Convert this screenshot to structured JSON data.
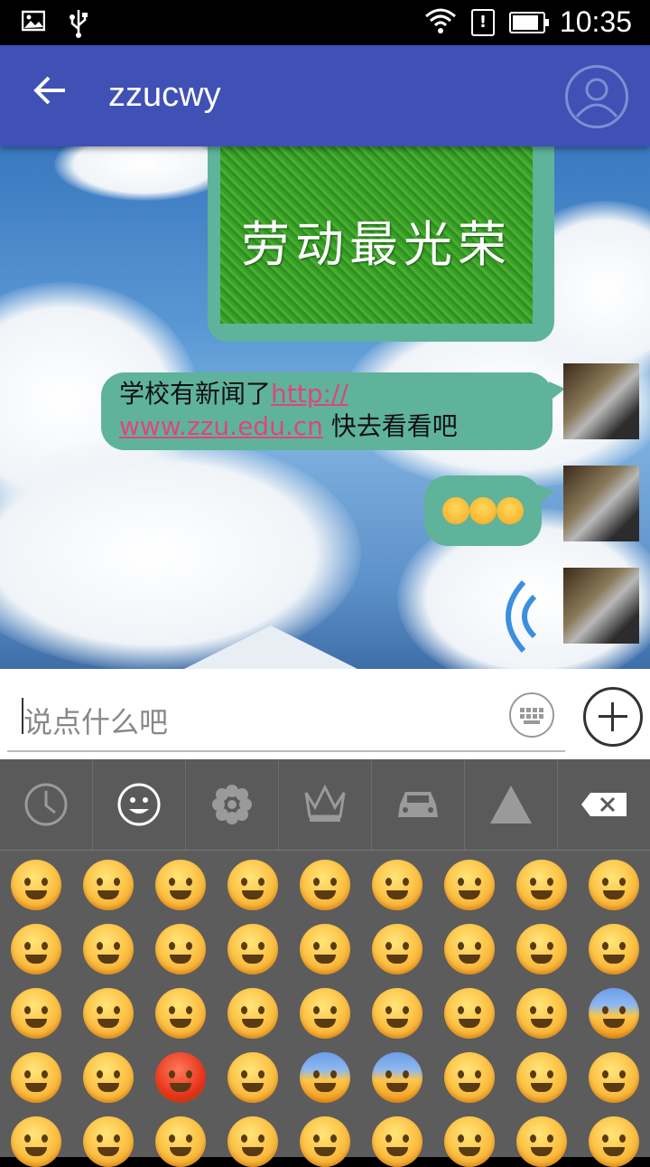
{
  "status_bar": {
    "time": "10:35",
    "alert_glyph": "!"
  },
  "header": {
    "title": "zzucwy"
  },
  "image_message": {
    "text": "劳动最光荣"
  },
  "message_1": {
    "text_before": "学校有新闻了",
    "link": "http://www.zzu.edu.cn",
    "link_part1": "http://",
    "link_part2": "www.zzu.edu.cn",
    "text_after": " 快去看看吧"
  },
  "message_2": {
    "emojis": [
      "squinting-tongue",
      "squinting-tongue",
      "squinting-tongue"
    ]
  },
  "input": {
    "placeholder": "说点什么吧"
  },
  "emoji_tabs": [
    "recent-icon",
    "smiley-icon",
    "flower-icon",
    "crown-icon",
    "car-icon",
    "triangle-icon",
    "backspace-icon"
  ],
  "emoji_grid_rows": 5,
  "emoji_grid_cols": 9
}
